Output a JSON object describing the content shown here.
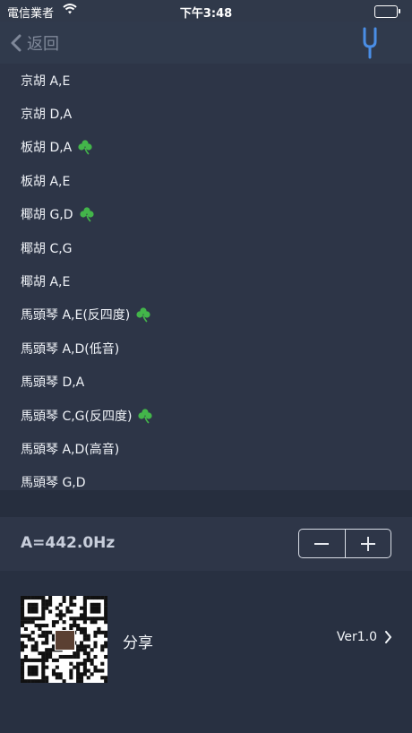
{
  "status_bar": {
    "carrier": "電信業者",
    "time": "下午3:48"
  },
  "nav": {
    "back_label": "返回",
    "icon": "tuning-fork-icon"
  },
  "tunings": [
    {
      "label": "京胡 A,E",
      "favorite": false
    },
    {
      "label": "京胡 D,A",
      "favorite": false
    },
    {
      "label": "板胡 D,A",
      "favorite": true
    },
    {
      "label": "板胡 A,E",
      "favorite": false
    },
    {
      "label": "椰胡 G,D",
      "favorite": true
    },
    {
      "label": "椰胡 C,G",
      "favorite": false
    },
    {
      "label": "椰胡 A,E",
      "favorite": false
    },
    {
      "label": "馬頭琴 A,E(反四度)",
      "favorite": true
    },
    {
      "label": "馬頭琴 A,D(低音)",
      "favorite": false
    },
    {
      "label": "馬頭琴 D,A",
      "favorite": false
    },
    {
      "label": "馬頭琴 C,G(反四度)",
      "favorite": true
    },
    {
      "label": "馬頭琴 A,D(高音)",
      "favorite": false
    },
    {
      "label": "馬頭琴 G,D",
      "favorite": false
    }
  ],
  "frequency": {
    "label": "A=442.0Hz",
    "minus_icon": "minus-icon",
    "plus_icon": "plus-icon"
  },
  "share": {
    "label": "分享",
    "version": "Ver1.0"
  },
  "colors": {
    "favorite_clover": "#43b54a",
    "battery": "#49d35a"
  }
}
